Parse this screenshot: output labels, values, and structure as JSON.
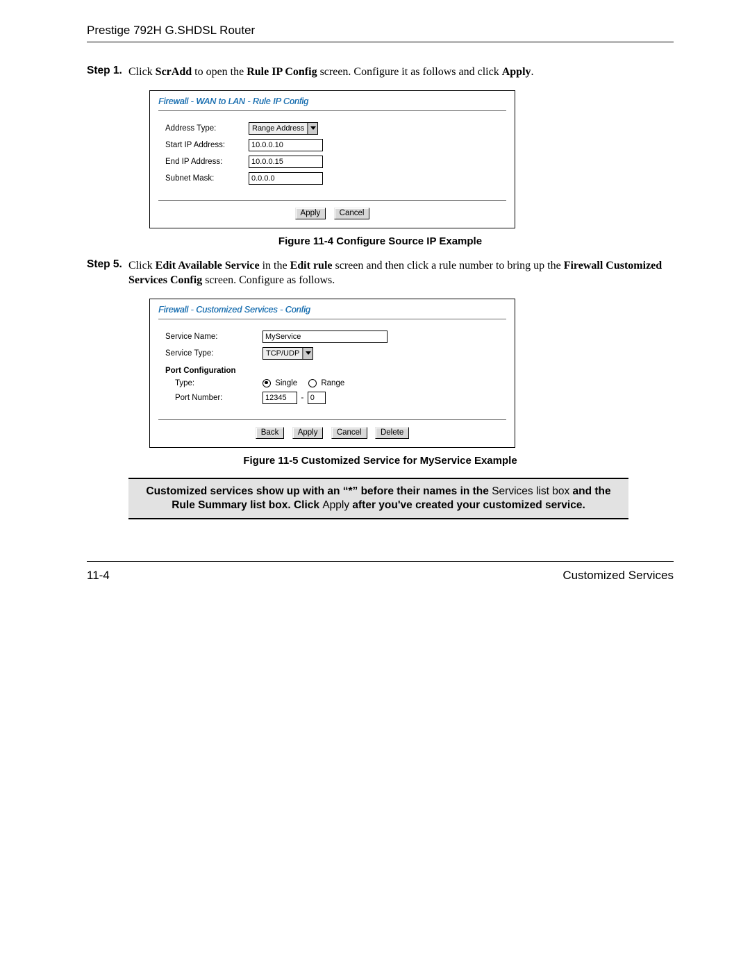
{
  "header": "Prestige 792H G.SHDSL Router",
  "step1": {
    "label": "Step 1.",
    "t1": "Click ",
    "b1": "ScrAdd",
    "t2": " to open the ",
    "b2": "Rule IP Config",
    "t3": " screen. Configure it as follows and click ",
    "b3": "Apply",
    "t4": "."
  },
  "panel1": {
    "title": "Firewall - WAN to LAN - Rule IP Config",
    "rows": {
      "addr_type_label": "Address Type:",
      "addr_type_value": "Range Address",
      "start_ip_label": "Start IP Address:",
      "start_ip_value": "10.0.0.10",
      "end_ip_label": "End IP Address:",
      "end_ip_value": "10.0.0.15",
      "subnet_label": "Subnet Mask:",
      "subnet_value": "0.0.0.0"
    },
    "btn_apply": "Apply",
    "btn_cancel": "Cancel"
  },
  "fig1_caption": "Figure 11-4 Configure Source IP Example",
  "step5": {
    "label": "Step 5.",
    "t1": "Click ",
    "b1": "Edit Available Service",
    "t2": " in the ",
    "b2": "Edit rule",
    "t3": " screen and then click a rule number to bring up the ",
    "b3": "Firewall Customized Services Config",
    "t4": " screen. Configure as follows."
  },
  "panel2": {
    "title": "Firewall - Customized Services - Config",
    "svc_name_label": "Service Name:",
    "svc_name_value": "MyService",
    "svc_type_label": "Service Type:",
    "svc_type_value": "TCP/UDP",
    "port_cfg_head": "Port Configuration",
    "port_type_label": "Type:",
    "radio_single": "Single",
    "radio_range": "Range",
    "port_num_label": "Port Number:",
    "port_num_a": "12345",
    "port_num_b": "0",
    "btn_back": "Back",
    "btn_apply": "Apply",
    "btn_cancel": "Cancel",
    "btn_delete": "Delete"
  },
  "fig2_caption": "Figure 11-5 Customized Service for MyService Example",
  "note": {
    "l1a": "Customized services show up with an “*” before their names in the ",
    "l1b": "Services list box",
    "l2a": " and the Rule Summary list box. Click ",
    "l2b": "Apply",
    "l2c": " after you've created your customized service."
  },
  "footer": {
    "left": "11-4",
    "right": "Customized Services"
  }
}
